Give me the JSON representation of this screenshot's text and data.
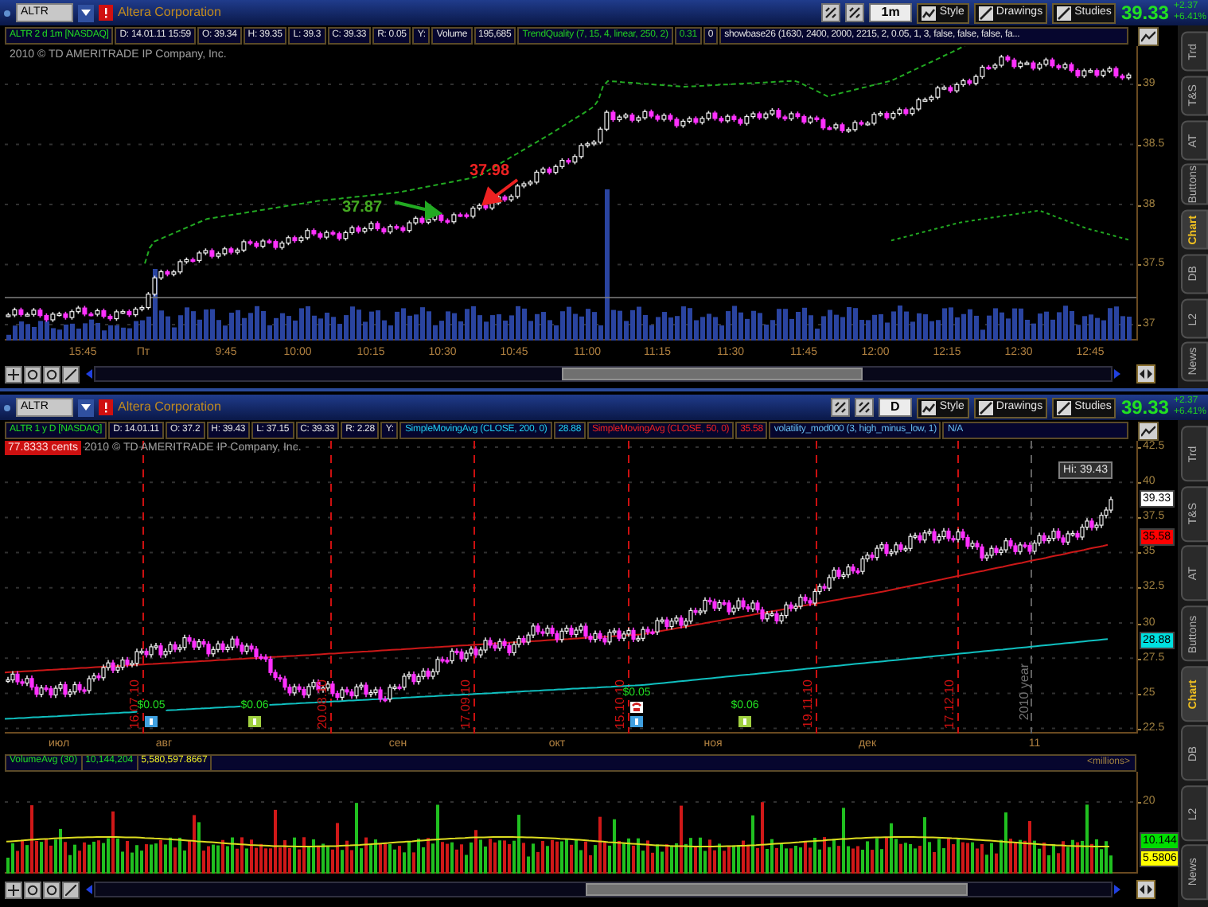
{
  "panes": [
    {
      "kind": "intraday",
      "symbol": "ALTR",
      "company": "Altera Corporation",
      "aggregation": "1m",
      "tools": [
        "Style",
        "Drawings",
        "Studies"
      ],
      "last": "39.33",
      "change": "+2.37",
      "change_pct": "+6.41%",
      "info": [
        {
          "text": "ALTR 2 d 1m [NASDAQ]",
          "kind": "title"
        },
        {
          "text": "D: 14.01.11 15:59",
          "kind": "field"
        },
        {
          "text": "O: 39.34",
          "kind": "field"
        },
        {
          "text": "H: 39.35",
          "kind": "field"
        },
        {
          "text": "L: 39.3",
          "kind": "field"
        },
        {
          "text": "C: 39.33",
          "kind": "field"
        },
        {
          "text": "R: 0.05",
          "kind": "field"
        },
        {
          "text": "Y:",
          "kind": "field"
        },
        {
          "text": "Volume",
          "kind": "field"
        },
        {
          "text": "195,685",
          "kind": "field"
        },
        {
          "text": "TrendQuality (7, 15, 4, linear, 250, 2)",
          "kind": "trend"
        },
        {
          "text": "0.31",
          "kind": "trend"
        },
        {
          "text": "0",
          "kind": "field"
        },
        {
          "text": "showbase26 (1630, 2400, 2000, 2215, 2, 0.05, 1, 3, false, false, false, fa...",
          "kind": "field"
        }
      ],
      "copyright": "2010 © TD AMERITRADE IP Company, Inc.",
      "price_axis": [
        "39",
        "38.5",
        "38",
        "37.5",
        "37"
      ],
      "time_axis": [
        "15:45",
        "Пт",
        "9:45",
        "10:00",
        "10:15",
        "10:30",
        "10:45",
        "11:00",
        "11:15",
        "11:30",
        "11:45",
        "12:00",
        "12:15",
        "12:30",
        "12:45"
      ],
      "annotations": [
        {
          "text": "37.87",
          "color": "#44aa22"
        },
        {
          "text": "37.98",
          "color": "#ee2222"
        }
      ],
      "tabs": [
        {
          "label": "Trd",
          "selected": false
        },
        {
          "label": "T&S",
          "selected": false
        },
        {
          "label": "AT",
          "selected": false
        },
        {
          "label": "Buttons",
          "selected": false
        },
        {
          "label": "Chart",
          "selected": true
        },
        {
          "label": "DB",
          "selected": false
        },
        {
          "label": "L2",
          "selected": false
        },
        {
          "label": "News",
          "selected": false
        }
      ]
    },
    {
      "kind": "daily",
      "symbol": "ALTR",
      "company": "Altera Corporation",
      "aggregation": "D",
      "tools": [
        "Style",
        "Drawings",
        "Studies"
      ],
      "last": "39.33",
      "change": "+2.37",
      "change_pct": "+6.41%",
      "info": [
        {
          "text": "ALTR 1 y D [NASDAQ]",
          "kind": "title"
        },
        {
          "text": "D: 14.01.11",
          "kind": "field"
        },
        {
          "text": "O: 37.2",
          "kind": "field"
        },
        {
          "text": "H: 39.43",
          "kind": "field"
        },
        {
          "text": "L: 37.15",
          "kind": "field"
        },
        {
          "text": "C: 39.33",
          "kind": "field"
        },
        {
          "text": "R: 2.28",
          "kind": "field"
        },
        {
          "text": "Y:",
          "kind": "field"
        },
        {
          "text": "SimpleMovingAvg (CLOSE, 200, 0)",
          "kind": "long_average"
        },
        {
          "text": "28.88",
          "kind": "long_average"
        },
        {
          "text": "SimpleMovingAvg (CLOSE, 50, 0)",
          "kind": "short_average"
        },
        {
          "text": "35.58",
          "kind": "short_average"
        },
        {
          "text": "volatility_mod000 (3, high_minus_low, 1)",
          "kind": "indicator"
        },
        {
          "text": "N/A",
          "kind": "indicator"
        }
      ],
      "badge": "77.8333 cents",
      "copyright": "2010 © TD AMERITRADE IP Company, Inc.",
      "price_axis": [
        "42.5",
        "40",
        "37.5",
        "35",
        "32.5",
        "30",
        "27.5",
        "25",
        "22.5"
      ],
      "price_labels": [
        {
          "text": "Hi: 39.43",
          "kind": "high",
          "color": "#303030"
        },
        {
          "text": "39.33",
          "kind": "last",
          "color": "#ffffff"
        },
        {
          "text": "35.58",
          "kind": "study",
          "color": "#ff0000"
        },
        {
          "text": "28.88",
          "kind": "study",
          "color": "#00e0e0"
        }
      ],
      "events": [
        "16.07.10",
        "20.08.10",
        "17.09.10",
        "15.10.10",
        "19.11.10",
        "17.12.10"
      ],
      "era": "2010 year",
      "dividends": [
        {
          "amount": "$0.05",
          "earnings": false,
          "color": "#40a0e0"
        },
        {
          "amount": "$0.06",
          "earnings": false,
          "color": "#a0d040"
        },
        {
          "amount": "$0.05",
          "earnings": true,
          "color": "#40a0e0"
        },
        {
          "amount": "$0.06",
          "earnings": false,
          "color": "#a0d040"
        }
      ],
      "time_axis": [
        "июл",
        "авг",
        "сен",
        "окт",
        "ноя",
        "дек",
        "11"
      ],
      "volume": {
        "info": [
          {
            "text": "VolumeAvg (30)",
            "kind": "title"
          },
          {
            "text": "10,144,204",
            "kind": "title"
          },
          {
            "text": "5,580,597.8667",
            "kind": "average"
          }
        ],
        "units": "<millions>",
        "axis": [
          "20"
        ],
        "labels": [
          {
            "text": "10.144",
            "color": "#00dd00"
          },
          {
            "text": "5.5806",
            "color": "#ffff00"
          }
        ]
      },
      "tabs": [
        {
          "label": "Trd",
          "selected": false
        },
        {
          "label": "T&S",
          "selected": false
        },
        {
          "label": "AT",
          "selected": false
        },
        {
          "label": "Buttons",
          "selected": false
        },
        {
          "label": "Chart",
          "selected": true
        },
        {
          "label": "DB",
          "selected": false
        },
        {
          "label": "L2",
          "selected": false
        },
        {
          "label": "News",
          "selected": false
        }
      ]
    }
  ]
}
